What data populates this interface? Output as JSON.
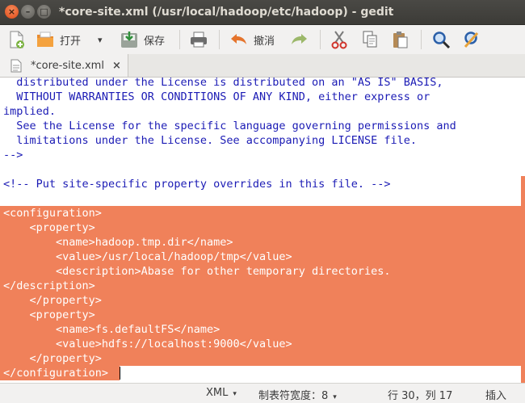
{
  "window": {
    "title": "*core-site.xml (/usr/local/hadoop/etc/hadoop) - gedit",
    "close_glyph": "×",
    "min_glyph": "–",
    "max_glyph": "□"
  },
  "toolbar": {
    "open_label": "打开",
    "save_label": "保存",
    "undo_label": "撤消",
    "dropdown_glyph": "▾"
  },
  "tab": {
    "label": "*core-site.xml",
    "close_glyph": "×"
  },
  "editor": {
    "lines": [
      "  distributed under the License is distributed on an \"AS IS\" BASIS,",
      "  WITHOUT WARRANTIES OR CONDITIONS OF ANY KIND, either express or",
      "implied.",
      "  See the License for the specific language governing permissions and",
      "  limitations under the License. See accompanying LICENSE file.",
      "-->",
      "",
      "<!-- Put site-specific property overrides in this file. -->",
      "",
      "<configuration>",
      "    <property>",
      "        <name>hadoop.tmp.dir</name>",
      "        <value>/usr/local/hadoop/tmp</value>",
      "        <description>Abase for other temporary directories.",
      "</description>",
      "    </property>",
      "    <property>",
      "        <name>fs.defaultFS</name>",
      "        <value>hdfs://localhost:9000</value>",
      "    </property>",
      "</configuration>"
    ],
    "selected_from_line": 9
  },
  "statusbar": {
    "language": "XML",
    "tab_width": "制表符宽度：8",
    "position": "行 30，列 17",
    "mode": "插入",
    "dropdown_glyph": "▾"
  },
  "colors": {
    "selection": "#f0815a",
    "text": "#1b1bb5"
  }
}
